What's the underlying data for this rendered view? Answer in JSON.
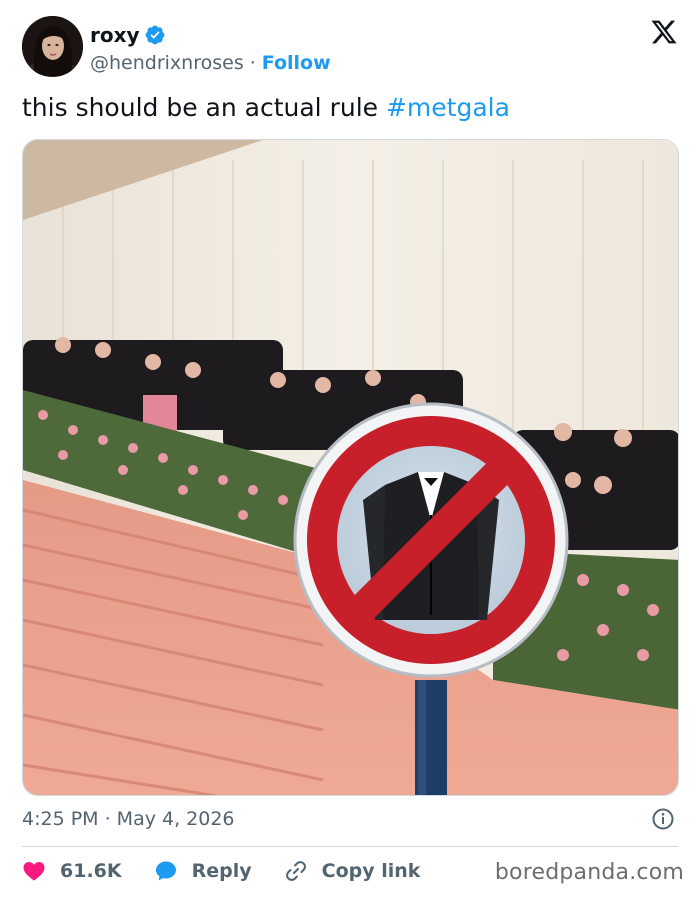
{
  "author": {
    "display_name": "roxy",
    "handle": "@hendrixnroses",
    "separator": "·",
    "follow_label": "Follow",
    "verified": true
  },
  "tweet": {
    "text": "this should be an actual rule ",
    "hashtag": "#metgala"
  },
  "media": {
    "description_icon": "no-tuxedo-sign"
  },
  "meta": {
    "timestamp": "4:25 PM · May 4, 2026"
  },
  "actions": {
    "likes": "61.6K",
    "reply_label": "Reply",
    "copy_link_label": "Copy link"
  },
  "watermark": "boredpanda.com",
  "colors": {
    "accent": "#1d9bf0",
    "like": "#f91880",
    "text_secondary": "#536471"
  }
}
